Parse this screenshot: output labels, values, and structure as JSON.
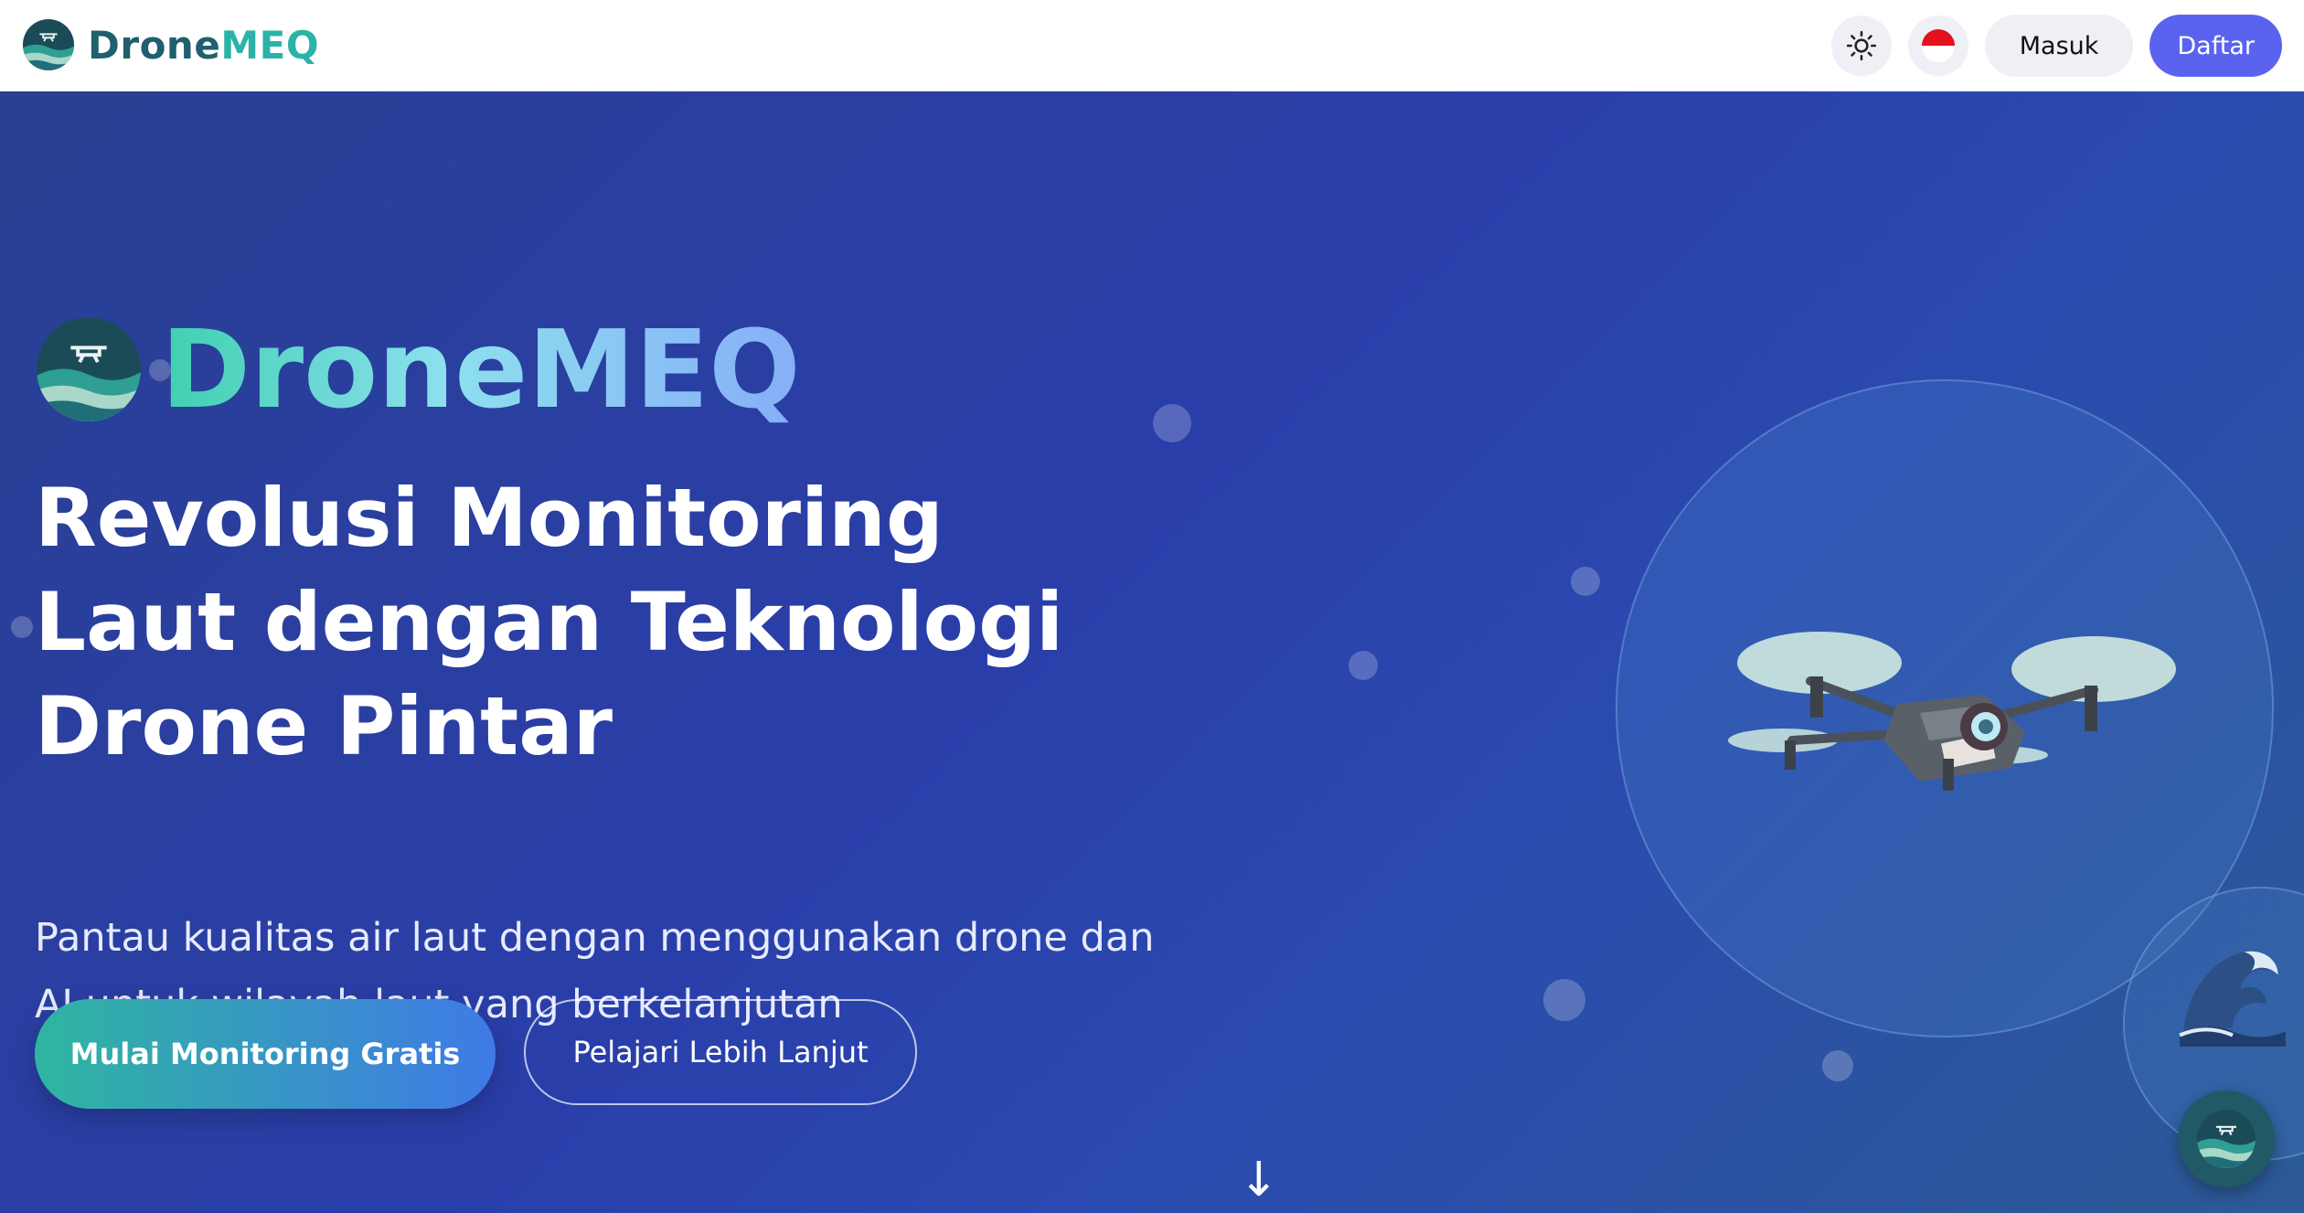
{
  "nav": {
    "brand_part1": "Drone",
    "brand_part2": "MEQ",
    "theme_icon": "sun-icon",
    "language_icon": "indonesia-flag-icon",
    "login_label": "Masuk",
    "register_label": "Daftar"
  },
  "hero": {
    "brand": "DroneMEQ",
    "headline": "Revolusi Monitoring Laut dengan Teknologi Drone Pintar",
    "subtitle": "Pantau kualitas air laut dengan menggunakan drone dan AI untuk wilayah laut yang berkelanjutan",
    "primary_cta": "Mulai Monitoring Gratis",
    "secondary_cta": "Pelajari Lebih Lanjut",
    "scroll_hint": "↓"
  },
  "colors": {
    "accent": "#5b63ee",
    "hero_bg": "#2a3eaa",
    "brand_dark": "#1f5f6e",
    "brand_teal": "#2bb3a8"
  }
}
